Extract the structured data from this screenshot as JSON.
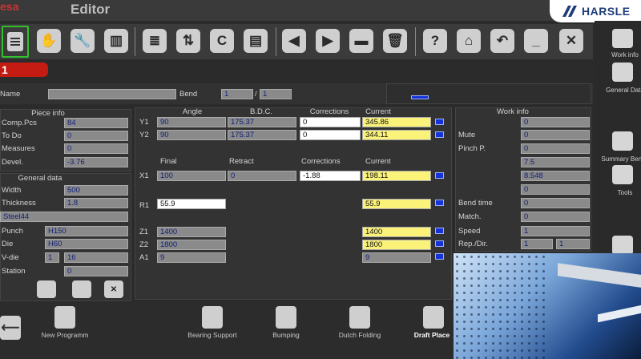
{
  "app": {
    "brand": "esa",
    "title": "Editor",
    "logo": "HARSLE"
  },
  "page": {
    "number": "1"
  },
  "sidebar": {
    "items": [
      {
        "label": "Work info",
        "icon": "work-info-icon"
      },
      {
        "label": "General Data",
        "icon": "general-data-icon"
      },
      {
        "label": "Summary Bends",
        "icon": "summary-bends-icon"
      },
      {
        "label": "Tools",
        "icon": "tools-icon"
      },
      {
        "label": "",
        "icon": "document-icon"
      }
    ]
  },
  "header": {
    "name_label": "Name",
    "name_value": "",
    "bend_label": "Bend",
    "bend_value": "1",
    "bend_sep": "/",
    "bend_total": "1"
  },
  "piece_info": {
    "title": "Piece info",
    "rows": [
      {
        "label": "Comp.Pcs",
        "value": "84"
      },
      {
        "label": "To Do",
        "value": "0"
      },
      {
        "label": "Measures",
        "value": "0"
      },
      {
        "label": "Devel.",
        "value": "-3.76"
      }
    ]
  },
  "general_data": {
    "title": "General data",
    "width_label": "Width",
    "width": "500",
    "thickness_label": "Thickness",
    "thickness": "1.8",
    "material": "Steel44",
    "punch_label": "Punch",
    "punch": "H150",
    "die_label": "Die",
    "die": "H60",
    "vdie_label": "V-die",
    "vdie_a": "1",
    "vdie_b": "16",
    "station_label": "Station",
    "station": "0"
  },
  "axes_top": {
    "headers": [
      "Angle",
      "B.D.C.",
      "Corrections",
      "Current"
    ],
    "rows": [
      {
        "axis": "Y1",
        "angle": "90",
        "bdc": "175.37",
        "corr": "0",
        "current": "345.86"
      },
      {
        "axis": "Y2",
        "angle": "90",
        "bdc": "175.37",
        "corr": "0",
        "current": "344.11"
      }
    ]
  },
  "axes_bottom": {
    "headers": [
      "Final",
      "Retract",
      "Corrections",
      "Current"
    ],
    "x1": {
      "axis": "X1",
      "final": "100",
      "retract": "0",
      "corr": "-1.88",
      "current": "198.11"
    },
    "r1": {
      "axis": "R1",
      "final": "55.9",
      "current": "55.9"
    },
    "z1": {
      "axis": "Z1",
      "final": "1400",
      "current": "1400"
    },
    "z2": {
      "axis": "Z2",
      "final": "1800",
      "current": "1800"
    },
    "a1": {
      "axis": "A1",
      "final": "9",
      "current": "9"
    }
  },
  "work_info": {
    "title": "Work info",
    "top": "0",
    "mute_label": "Mute",
    "mute": "0",
    "pinch_label": "Pinch P.",
    "pinch": "0",
    "v1": "7.5",
    "v2": "8.548",
    "v3": "0",
    "bendtime_label": "Bend time",
    "bendtime": "0",
    "match_label": "Match.",
    "match": "0",
    "speed_label": "Speed",
    "speed": "1",
    "rep_label": "Rep./Dir.",
    "rep_a": "1",
    "rep_b": "1"
  },
  "bottom": {
    "new_program": "New Programm",
    "bearing_support": "Bearing Support",
    "bumping": "Bumping",
    "dutch_folding": "Dutch Folding",
    "draft_place": "Draft Place"
  },
  "colors": {
    "accent_red": "#c41b12",
    "selected_green": "#35c02e",
    "current_yellow": "#fbf27a",
    "indicator_blue": "#1533d8"
  }
}
